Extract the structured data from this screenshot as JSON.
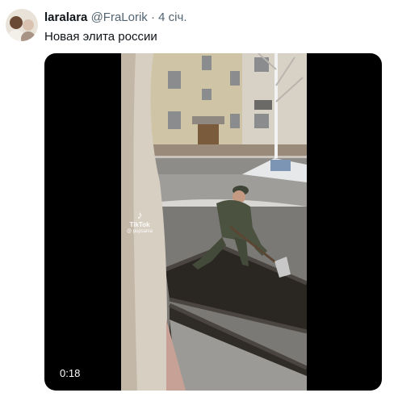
{
  "tweet": {
    "display_name": "laralara",
    "handle": "@FraLorik",
    "separator": "·",
    "time": "4 січ.",
    "text": "Новая элита россии"
  },
  "media": {
    "watermark": {
      "logo_icon": "tiktok-logo-icon",
      "name": "TikTok",
      "user": "@ pupsania"
    },
    "duration": "0:18"
  },
  "colors": {
    "text_primary": "#0f1419",
    "text_secondary": "#536471",
    "media_background": "#000000"
  }
}
